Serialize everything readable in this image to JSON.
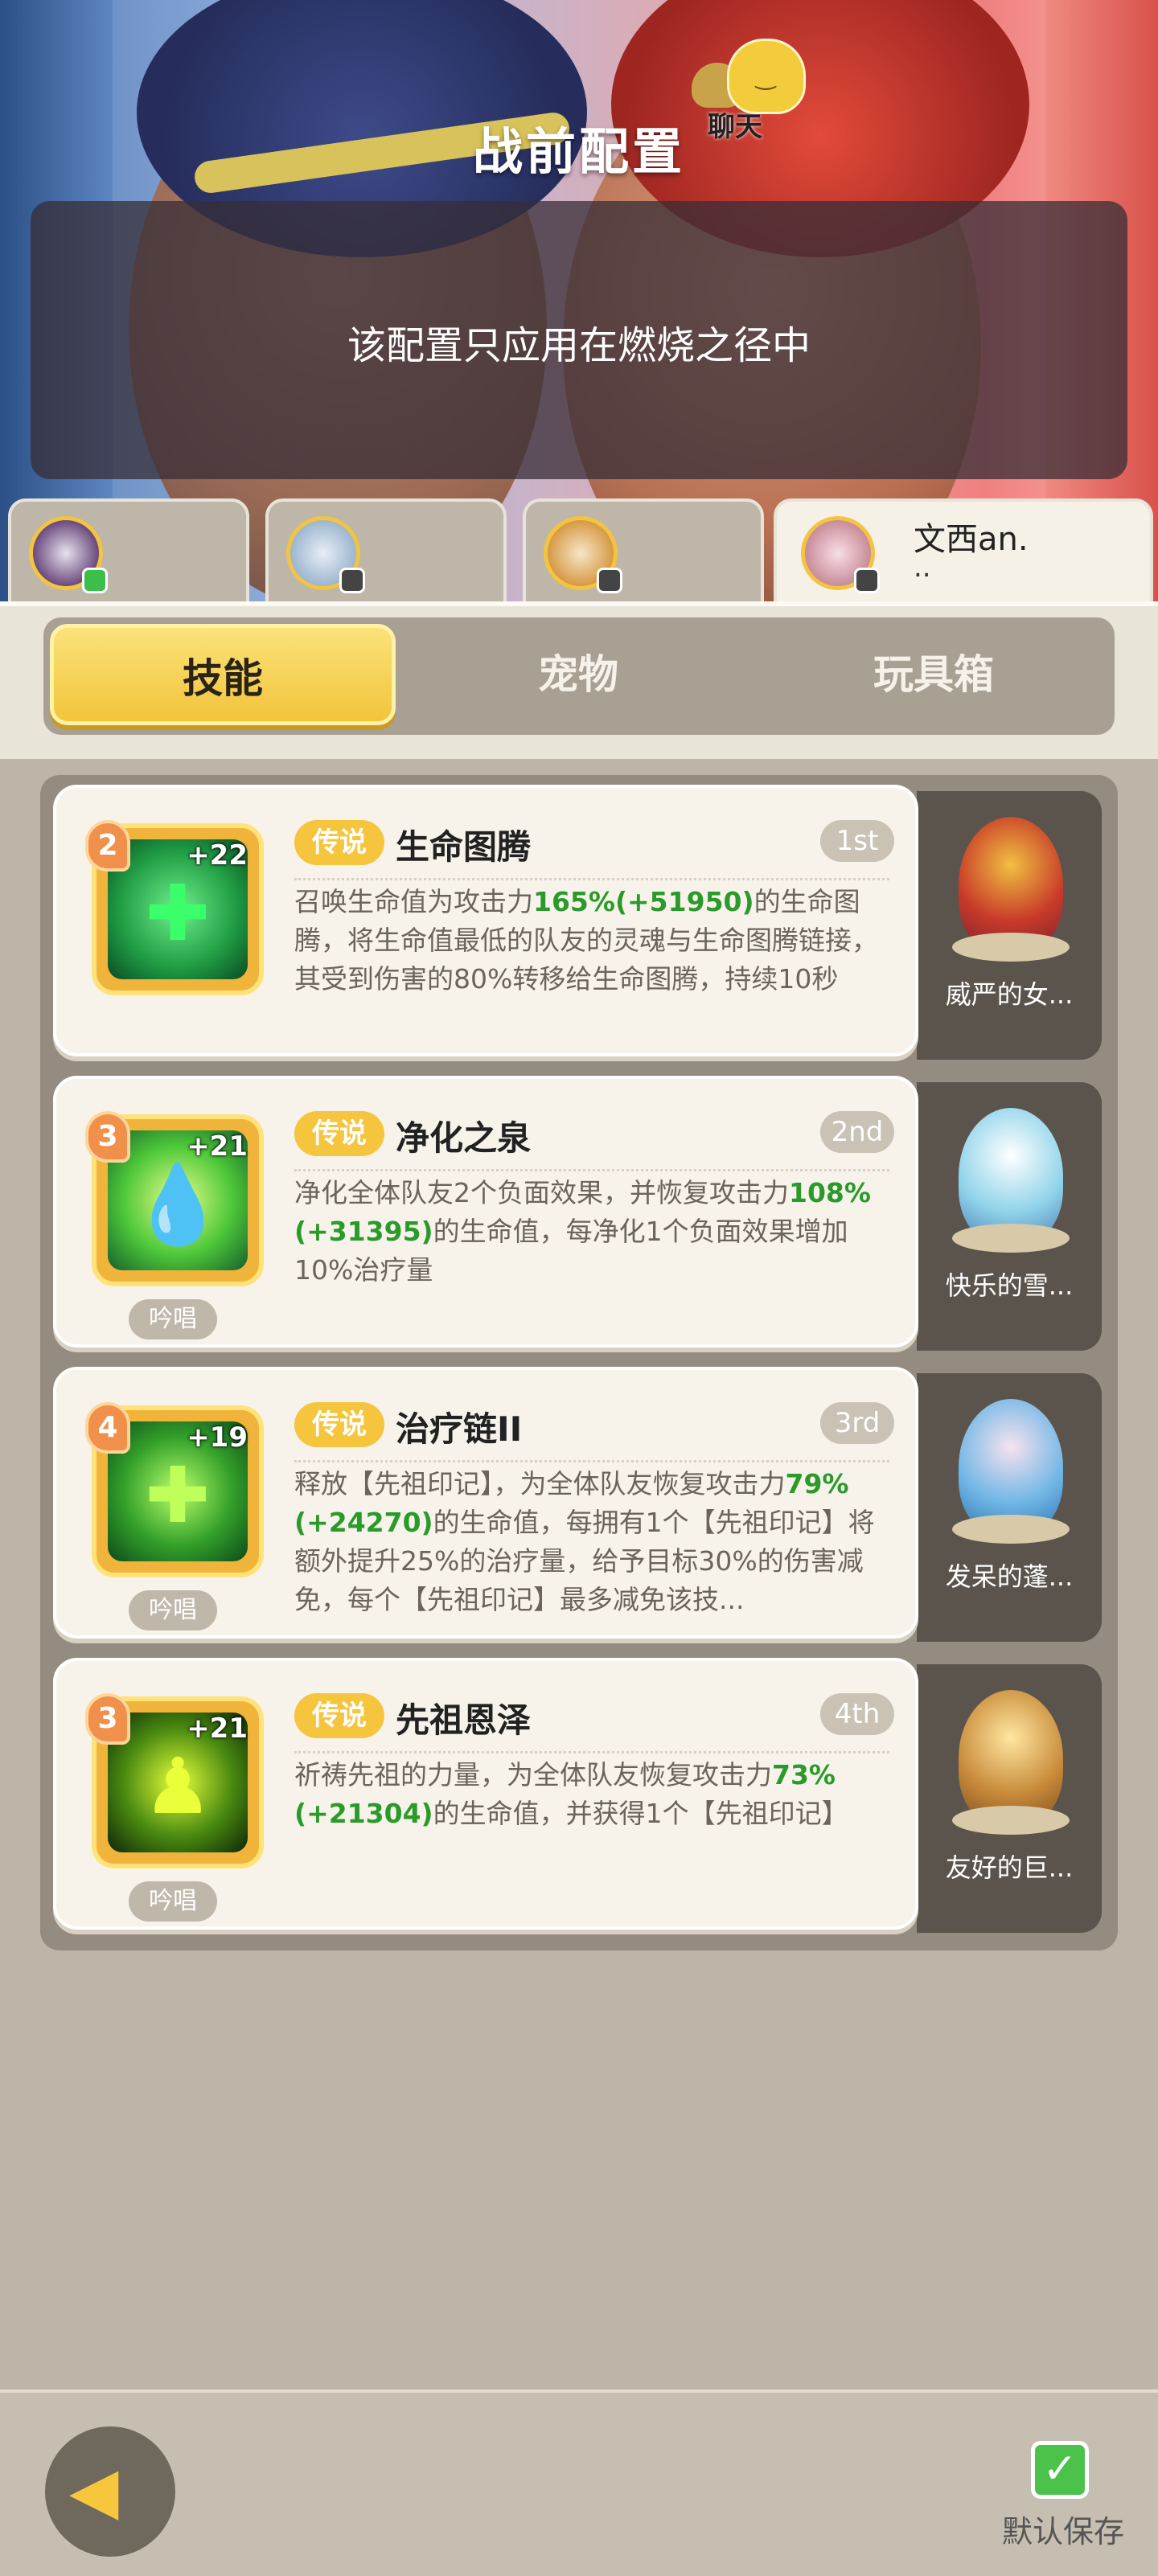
{
  "header": {
    "title": "战前配置",
    "chat_label": "聊天",
    "notice": "该配置只应用在燃烧之径中"
  },
  "players": [
    {
      "name": ""
    },
    {
      "name": ""
    },
    {
      "name": ""
    },
    {
      "name": "文西an.",
      "sub": ".."
    }
  ],
  "subtabs": [
    {
      "label": "技能",
      "active": true
    },
    {
      "label": "宠物",
      "active": false
    },
    {
      "label": "玩具箱",
      "active": false
    }
  ],
  "skills": [
    {
      "level": "2",
      "plus": "+22",
      "rarity": "传说",
      "name": "生命图腾",
      "rank": "1st",
      "chant": "",
      "desc": "召唤生命值为攻击力165%(+51950)的生命图腾，将生命值最低的队友的灵魂与生命图腾链接，其受到伤害的80%转移给生命图腾，持续10秒",
      "pet": "威严的女..."
    },
    {
      "level": "3",
      "plus": "+21",
      "rarity": "传说",
      "name": "净化之泉",
      "rank": "2nd",
      "chant": "吟唱",
      "desc": "净化全体队友2个负面效果，并恢复攻击力108%(+31395)的生命值，每净化1个负面效果增加10%治疗量",
      "pet": "快乐的雪..."
    },
    {
      "level": "4",
      "plus": "+19",
      "rarity": "传说",
      "name": "治疗链II",
      "rank": "3rd",
      "chant": "吟唱",
      "desc": "释放【先祖印记】，为全体队友恢复攻击力79%(+24270)的生命值，每拥有1个【先祖印记】将额外提升25%的治疗量，给予目标30%的伤害减免，每个【先祖印记】最多减免该技...",
      "pet": "发呆的蓬..."
    },
    {
      "level": "3",
      "plus": "+21",
      "rarity": "传说",
      "name": "先祖恩泽",
      "rank": "4th",
      "chant": "吟唱",
      "desc": "祈祷先祖的力量，为全体队友恢复攻击力73%(+21304)的生命值，并获得1个【先祖印记】",
      "pet": "友好的巨..."
    }
  ],
  "footer": {
    "save_label": "默认保存",
    "back_icon": "back-arrow-icon",
    "save_checked": true
  },
  "colors": {
    "accent": "#f2c43a",
    "green": "#2a9a2a",
    "panel": "#948c80"
  }
}
